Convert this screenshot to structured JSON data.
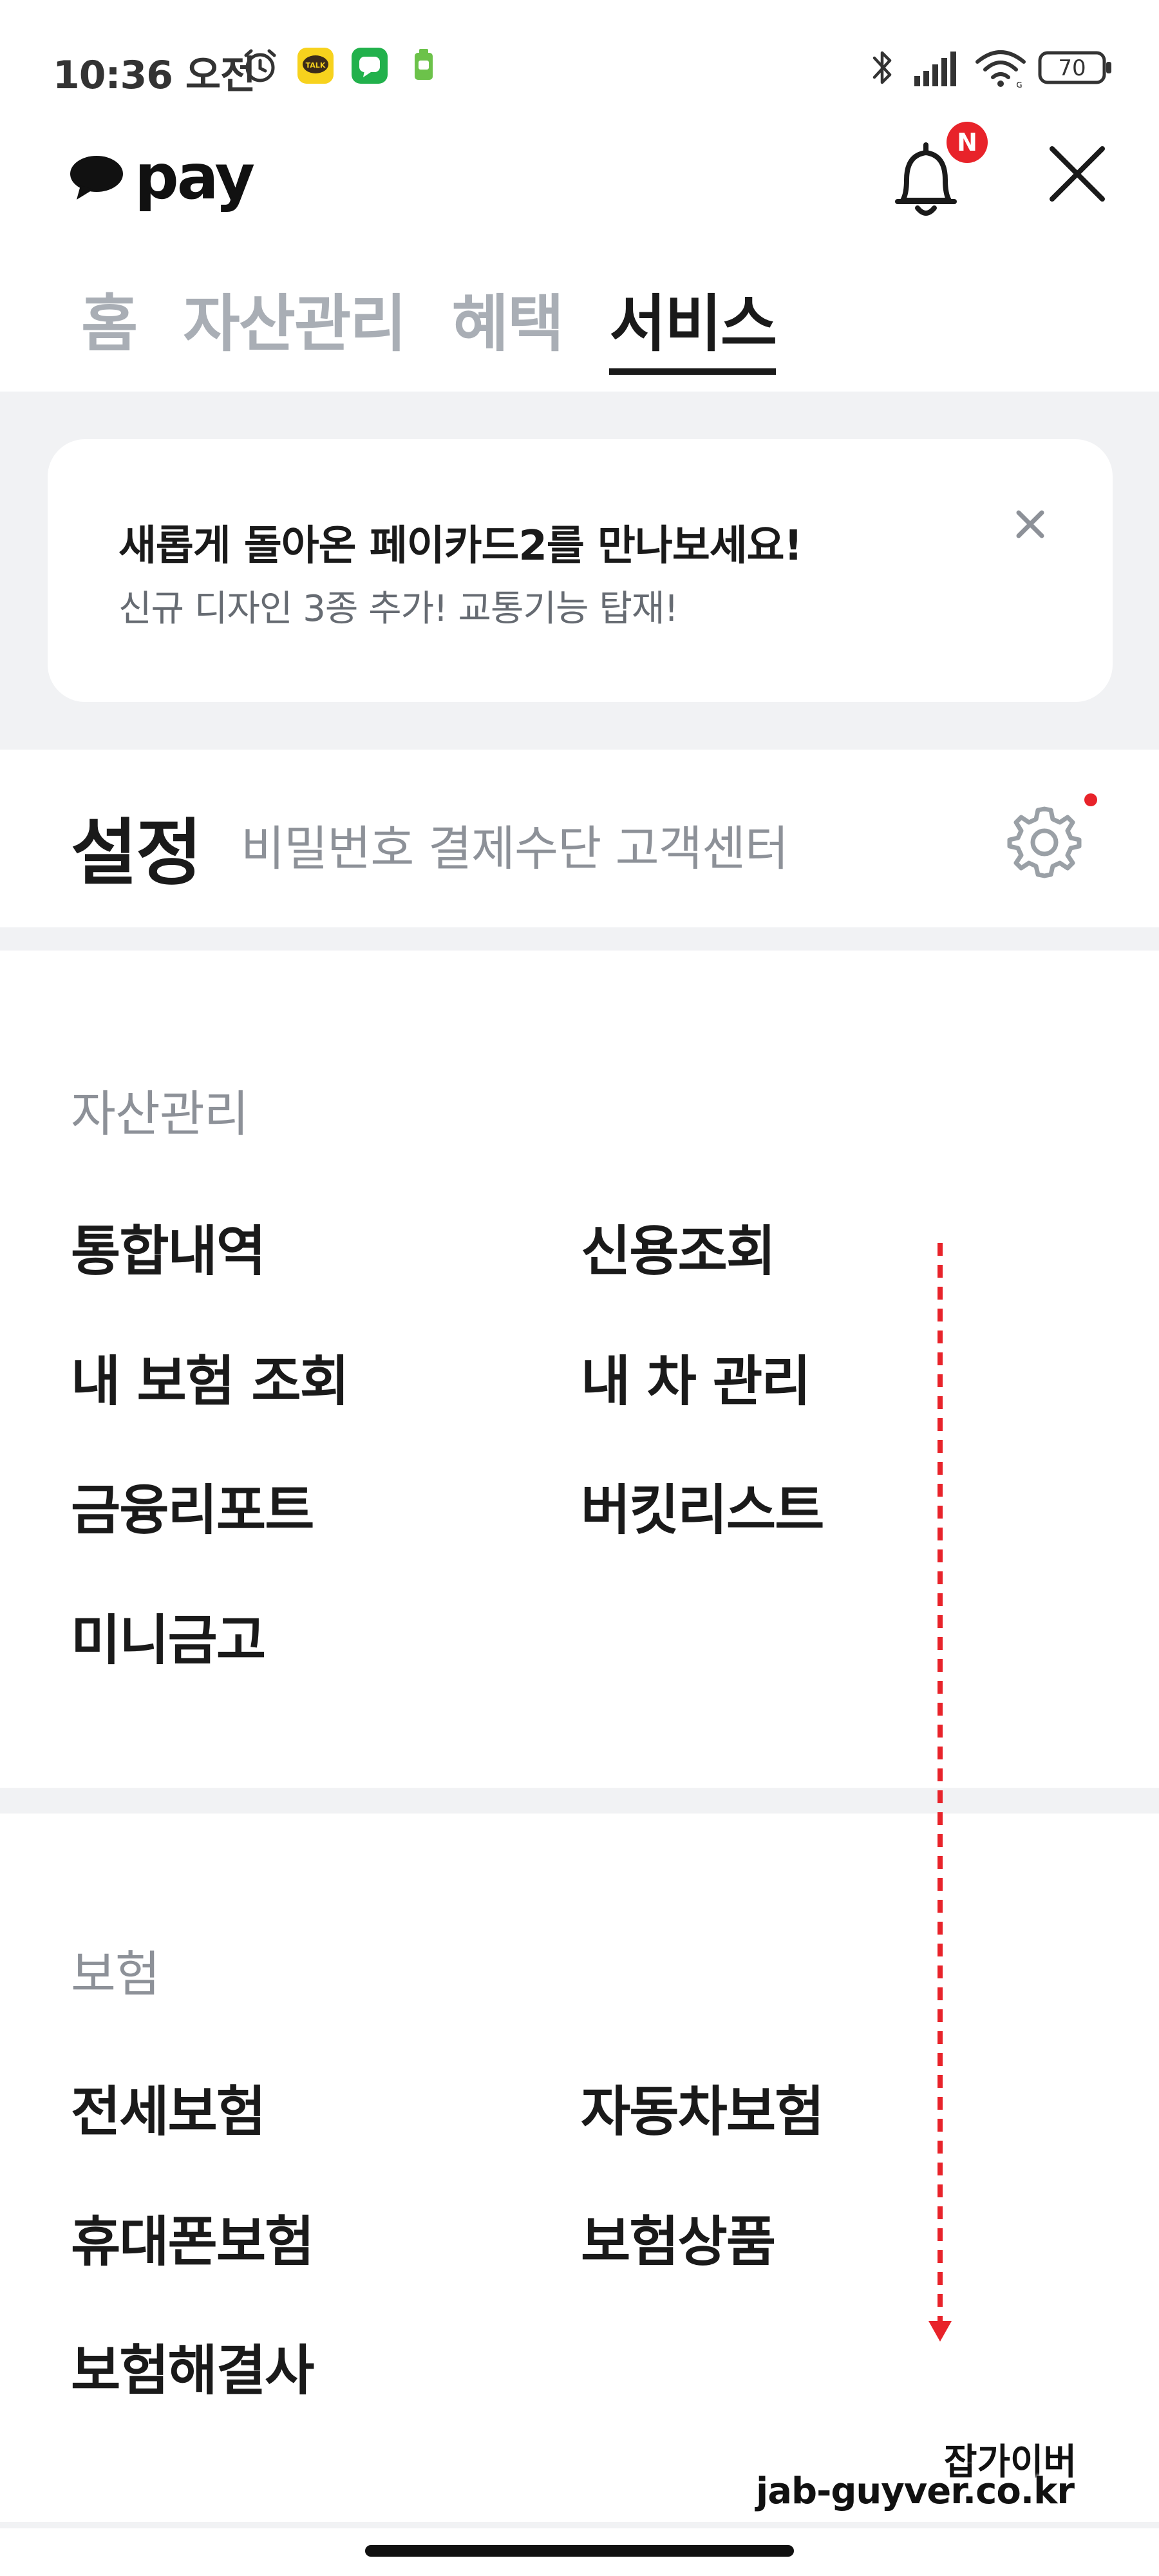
{
  "status_bar": {
    "time": "10:36 오전",
    "battery": "70",
    "icons": [
      "alarm-icon",
      "kakaotalk-icon",
      "line-icon",
      "cleaner-icon",
      "bluetooth-icon",
      "signal-icon",
      "wifi-icon",
      "battery-icon"
    ]
  },
  "header": {
    "logo_text": "pay",
    "notification_badge": "N"
  },
  "tabs": [
    {
      "label": "홈",
      "active": false
    },
    {
      "label": "자산관리",
      "active": false
    },
    {
      "label": "혜택",
      "active": false
    },
    {
      "label": "서비스",
      "active": true
    }
  ],
  "banner": {
    "title": "새롭게 돌아온 페이카드2를 만나보세요!",
    "subtitle": "신규 디자인 3종 추가! 교통기능 탑재!"
  },
  "settings": {
    "title": "설정",
    "subtitle": "비밀번호 결제수단 고객센터"
  },
  "sections": [
    {
      "title": "자산관리",
      "items": [
        "통합내역",
        "신용조회",
        "내 보험 조회",
        "내 차 관리",
        "금융리포트",
        "버킷리스트",
        "미니금고"
      ]
    },
    {
      "title": "보험",
      "items": [
        "전세보험",
        "자동차보험",
        "휴대폰보험",
        "보험상품",
        "보험해결사"
      ]
    }
  ],
  "watermark": {
    "line1": "잡가이버",
    "line2": "jab-guyver.co.kr"
  },
  "colors": {
    "accent_red": "#e8232a",
    "band_gray": "#f1f2f4",
    "muted_text": "#8d9198",
    "tab_inactive": "#a9aeb5"
  }
}
